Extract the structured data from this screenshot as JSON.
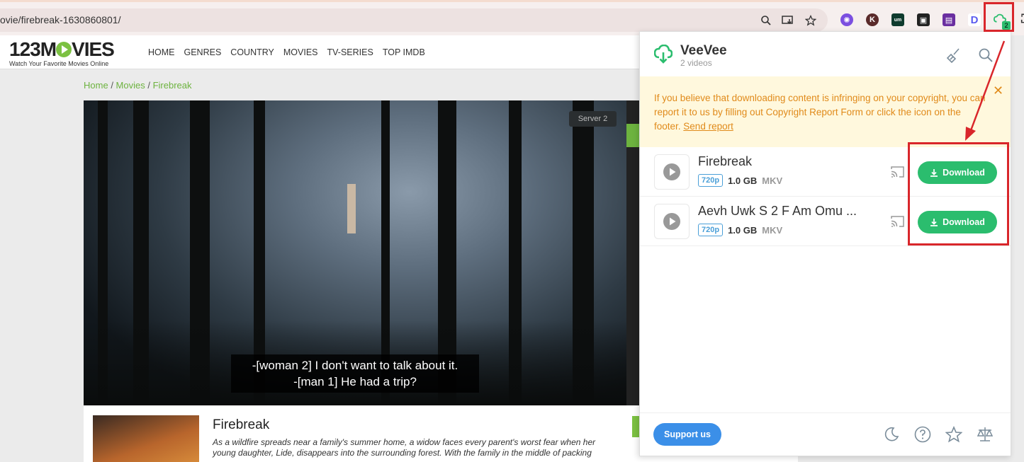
{
  "browser": {
    "url": "ovie/firebreak-1630860801/",
    "extension_badge_count": "2"
  },
  "site": {
    "logo": "123MOVIES",
    "logo_sub": "Watch Your Favorite Movies Online",
    "nav": [
      "HOME",
      "GENRES",
      "COUNTRY",
      "MOVIES",
      "TV-SERIES",
      "TOP IMDB"
    ],
    "breadcrumb": {
      "home": "Home",
      "movies": "Movies",
      "current": "Firebreak"
    },
    "server_badge": "Server 2",
    "subtitle_line1": "-[woman 2] I don't want to talk about it.",
    "subtitle_line2": "-[man 1] He had a trip?",
    "movie_title": "Firebreak",
    "movie_desc": "As a wildfire spreads near a family's summer home, a widow faces every parent's worst fear when her young daughter, Lide, disappears into the surrounding forest. With the family in the middle of packing"
  },
  "popup": {
    "name": "VeeVee",
    "count": "2 videos",
    "notice_text": "If you believe that downloading content is infringing on your copyright, you can report it to us by filling out Copyright Report Form or click the icon on the footer.",
    "notice_link": "Send report",
    "videos": [
      {
        "title": "Firebreak",
        "resolution": "720p",
        "size": "1.0 GB",
        "format": "MKV",
        "button": "Download"
      },
      {
        "title": "Aevh Uwk S 2 F Am Omu ...",
        "resolution": "720p",
        "size": "1.0 GB",
        "format": "MKV",
        "button": "Download"
      }
    ],
    "support_label": "Support us"
  },
  "colors": {
    "accent_green": "#2bbd6e",
    "site_green": "#6db33f",
    "support_blue": "#3b8fe8",
    "notice_orange": "#e08a1a",
    "annotation_red": "#d9262b"
  }
}
